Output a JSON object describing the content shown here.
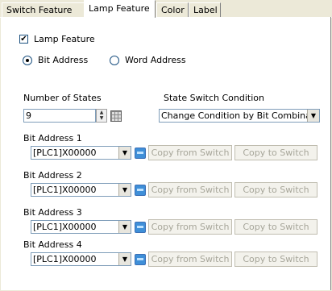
{
  "tabs": [
    {
      "label": "Switch Feature"
    },
    {
      "label": "Lamp Feature"
    },
    {
      "label": "Color"
    },
    {
      "label": "Label"
    }
  ],
  "lamp_feature": {
    "label": "Lamp Feature",
    "checked": true
  },
  "address_type": {
    "bit": {
      "label": "Bit Address",
      "selected": true
    },
    "word": {
      "label": "Word Address",
      "selected": false
    }
  },
  "states": {
    "label": "Number of States",
    "value": "9"
  },
  "switch_condition": {
    "label": "State Switch Condition",
    "value": "Change Condition by Bit Combinat"
  },
  "bit_addresses": [
    {
      "label": "Bit Address 1",
      "value": "[PLC1]X00000"
    },
    {
      "label": "Bit Address 2",
      "value": "[PLC1]X00000"
    },
    {
      "label": "Bit Address 3",
      "value": "[PLC1]X00000"
    },
    {
      "label": "Bit Address 4",
      "value": "[PLC1]X00000"
    }
  ],
  "buttons": {
    "copy_from": "Copy from Switch",
    "copy_to": "Copy to Switch"
  },
  "icons": {
    "check": "✔",
    "dropdown": "▼",
    "spin_up": "▲",
    "spin_down": "▼"
  }
}
